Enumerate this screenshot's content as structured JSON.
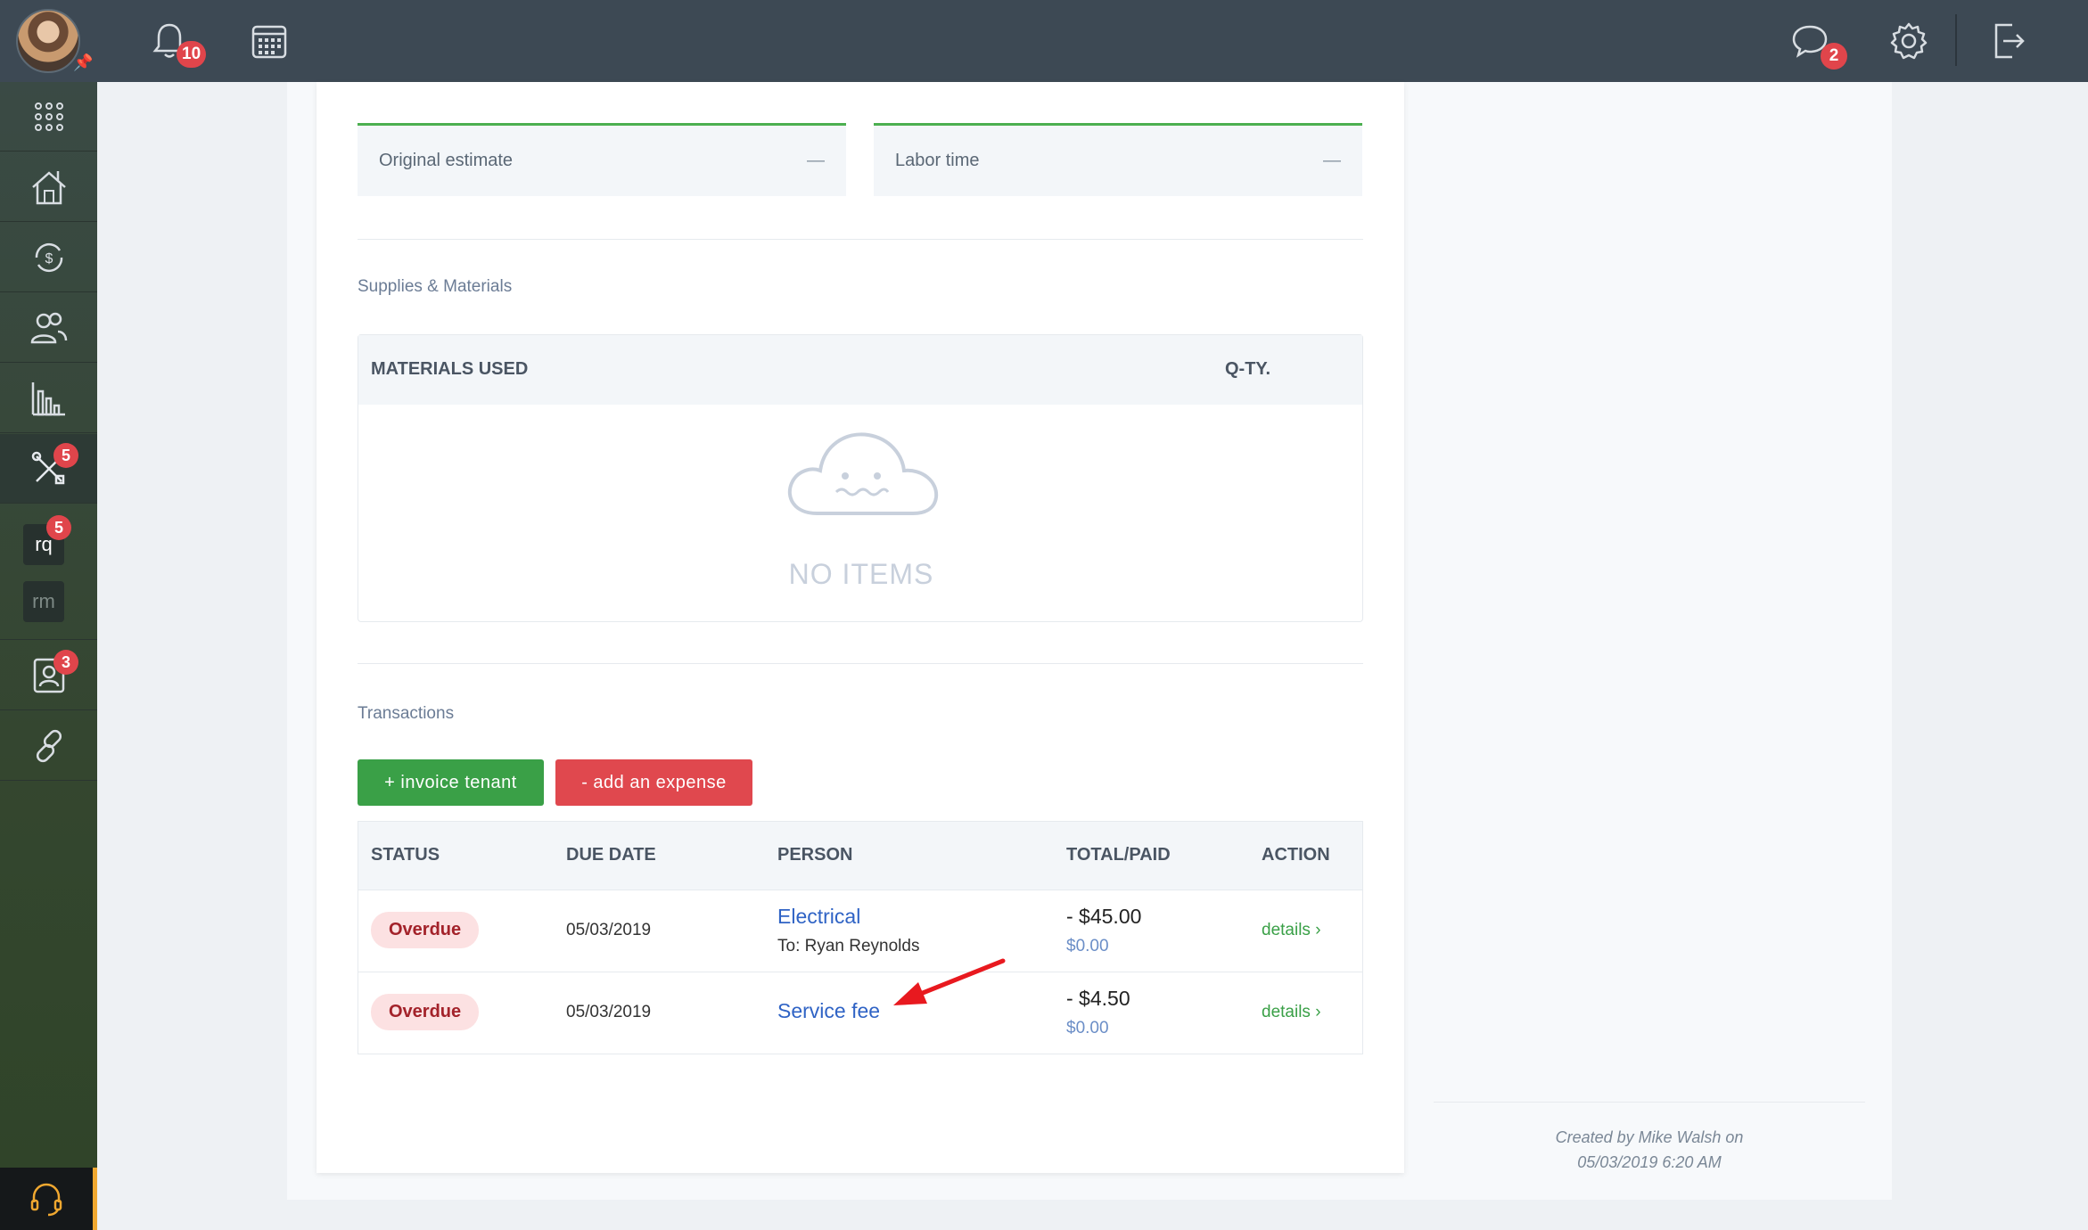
{
  "topbar": {
    "notifications_count": "10",
    "messages_count": "2"
  },
  "sidebar": {
    "maintenance_badge": "5",
    "rq_label": "rq",
    "rq_badge": "5",
    "rm_label": "rm",
    "contacts_badge": "3"
  },
  "estimates": {
    "original_label": "Original estimate",
    "original_value": "—",
    "labor_label": "Labor time",
    "labor_value": "—"
  },
  "supplies": {
    "title": "Supplies & Materials",
    "col_materials": "MATERIALS USED",
    "col_qty": "Q-TY.",
    "empty_text": "NO ITEMS"
  },
  "transactions": {
    "title": "Transactions",
    "invoice_button": "+ invoice tenant",
    "expense_button": "- add an expense",
    "columns": {
      "status": "STATUS",
      "due_date": "DUE DATE",
      "person": "PERSON",
      "total_paid": "TOTAL/PAID",
      "action": "ACTION"
    },
    "rows": [
      {
        "status": "Overdue",
        "due_date": "05/03/2019",
        "person": "Electrical",
        "to": "To: Ryan Reynolds",
        "total": "- $45.00",
        "paid": "$0.00",
        "action": "details ›"
      },
      {
        "status": "Overdue",
        "due_date": "05/03/2019",
        "person": "Service fee",
        "to": "",
        "total": "- $4.50",
        "paid": "$0.00",
        "action": "details ›"
      }
    ]
  },
  "footer": {
    "created_line1": "Created by Mike Walsh on",
    "created_line2": "05/03/2019 6:20 AM"
  },
  "colors": {
    "topbar": "#3d4954",
    "accent_green": "#3aa047",
    "accent_red": "#e0484e",
    "link_blue": "#2f63c5",
    "arrow_red": "#e8191f"
  }
}
